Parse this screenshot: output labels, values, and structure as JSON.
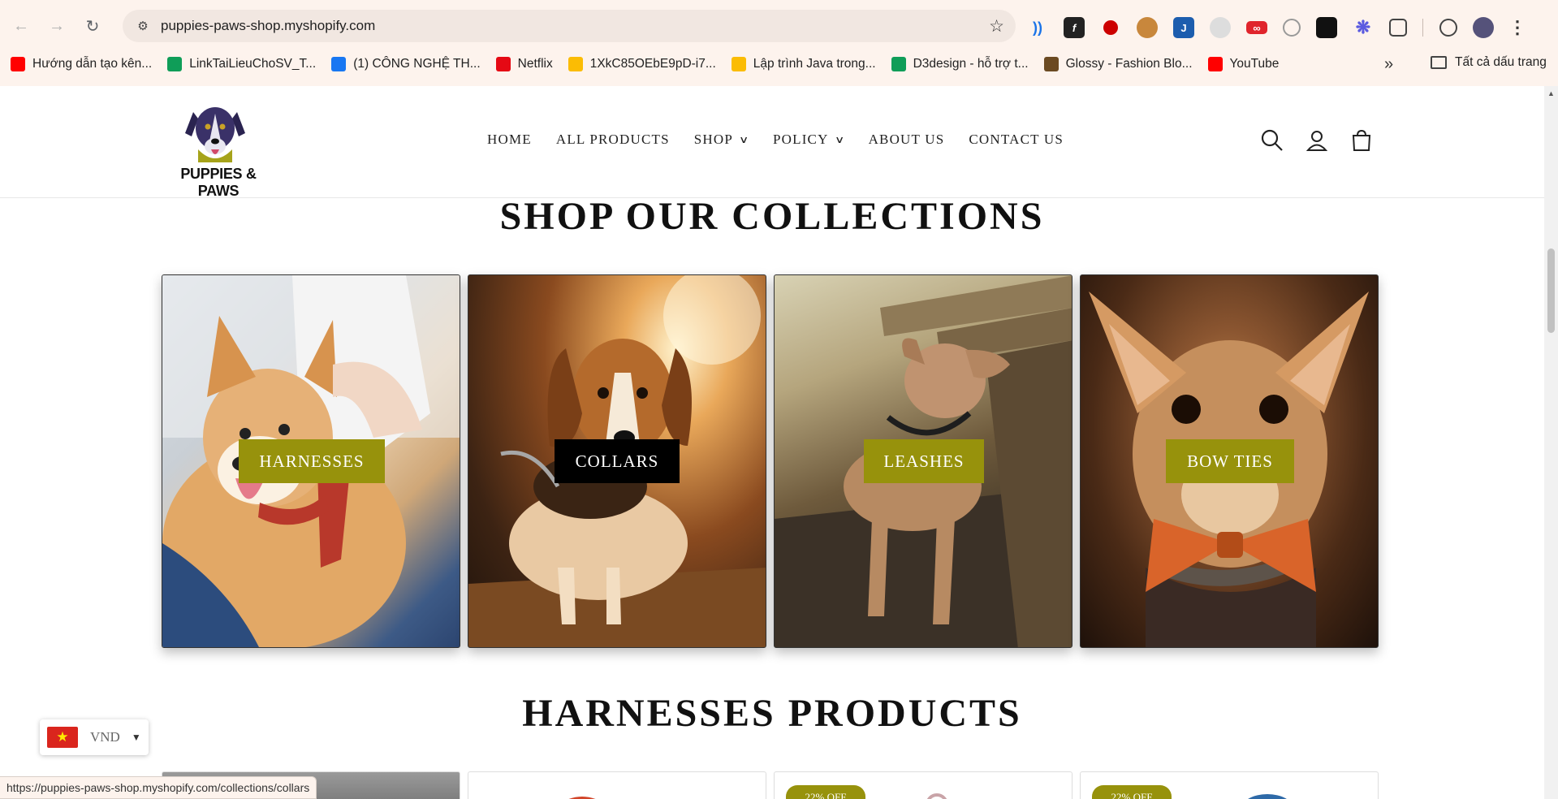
{
  "browser": {
    "url": "puppies-paws-shop.myshopify.com",
    "status_url": "https://puppies-paws-shop.myshopify.com/collections/collars",
    "bookmarks": [
      {
        "label": "Hướng dẫn tạo kên...",
        "icon": "youtube-icon",
        "color": "#ff0000"
      },
      {
        "label": "LinkTaiLieuChoSV_T...",
        "icon": "sheets-icon",
        "color": "#0f9d58"
      },
      {
        "label": "(1) CÔNG NGHỆ TH...",
        "icon": "facebook-icon",
        "color": "#1877f2"
      },
      {
        "label": "Netflix",
        "icon": "netflix-icon",
        "color": "#e50914"
      },
      {
        "label": "1XkC85OEbE9pD-i7...",
        "icon": "drive-icon",
        "color": "#fbbc04"
      },
      {
        "label": "Lập trình Java trong...",
        "icon": "drive-icon",
        "color": "#fbbc04"
      },
      {
        "label": "D3design - hỗ trợ t...",
        "icon": "sheets-icon",
        "color": "#0f9d58"
      },
      {
        "label": "Glossy - Fashion Blo...",
        "icon": "glossy-icon",
        "color": "#6b4a22"
      },
      {
        "label": "YouTube",
        "icon": "youtube-icon",
        "color": "#ff0000"
      }
    ],
    "all_bookmarks_label": "Tất cả dấu trang"
  },
  "site": {
    "logo_text": "PUPPIES & PAWS",
    "nav": [
      {
        "label": "HOME",
        "dropdown": false
      },
      {
        "label": "ALL PRODUCTS",
        "dropdown": false
      },
      {
        "label": "SHOP",
        "dropdown": true
      },
      {
        "label": "POLICY",
        "dropdown": true
      },
      {
        "label": "ABOUT US",
        "dropdown": false
      },
      {
        "label": "CONTACT US",
        "dropdown": false
      }
    ],
    "accent_color": "#97920c"
  },
  "collections": {
    "title": "SHOP OUR COLLECTIONS",
    "items": [
      {
        "label": "HARNESSES"
      },
      {
        "label": "COLLARS"
      },
      {
        "label": "LEASHES"
      },
      {
        "label": "BOW TIES"
      }
    ]
  },
  "products": {
    "title": "HARNESSES PRODUCTS",
    "badges": [
      "22% OFF",
      "22% OFF"
    ]
  },
  "currency": {
    "code": "VND",
    "flag": "vietnam-flag-icon"
  }
}
